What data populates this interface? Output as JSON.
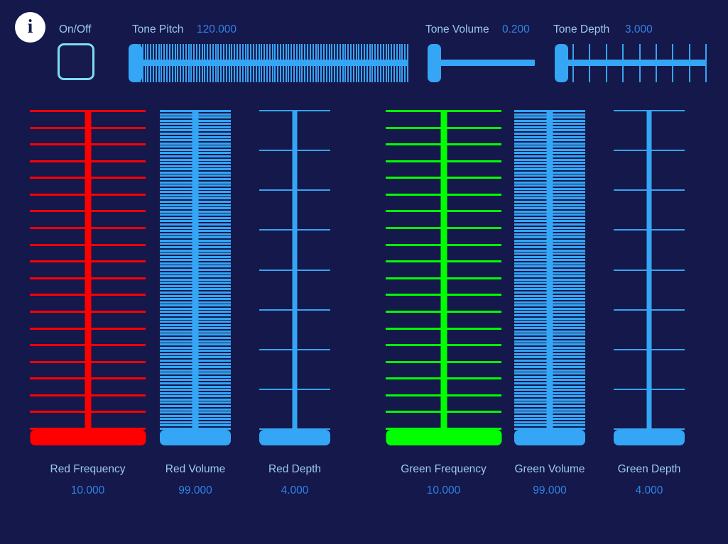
{
  "theme": {
    "background": "#15184a",
    "accent_blue": "#35a5f5",
    "label_color": "#9cc8f0",
    "value_color": "#2f83e8",
    "red": "#ff0000",
    "green": "#00ff00",
    "checkbox_border": "#7fdcf5",
    "info_bg": "#ffffff"
  },
  "header": {
    "info_icon": "info-icon",
    "info_glyph": "i",
    "onoff": {
      "label": "On/Off",
      "checked": false
    },
    "sliders": [
      {
        "name": "tone-pitch",
        "label": "Tone Pitch",
        "value": "120.000",
        "value_num": 120.0,
        "ticks": 100,
        "fill_ratio": 0.0,
        "color": "#35a5f5"
      },
      {
        "name": "tone-volume",
        "label": "Tone Volume",
        "value": "0.200",
        "value_num": 0.2,
        "ticks": 0,
        "fill_ratio": 0.0,
        "color": "#35a5f5"
      },
      {
        "name": "tone-depth",
        "label": "Tone Depth",
        "value": "3.000",
        "value_num": 3.0,
        "ticks": 9,
        "fill_ratio": 0.0,
        "color": "#35a5f5"
      }
    ]
  },
  "main": {
    "sliders": [
      {
        "name": "red-frequency",
        "label": "Red Frequency",
        "value": "10.000",
        "value_num": 10.0,
        "ticks": 20,
        "color": "#ff0000",
        "stem_width": 9,
        "tick_height": 3
      },
      {
        "name": "red-volume",
        "label": "Red Volume",
        "value": "99.000",
        "value_num": 99.0,
        "ticks": 99,
        "color": "#35a5f5",
        "stem_width": 9,
        "tick_height": 3
      },
      {
        "name": "red-depth",
        "label": "Red Depth",
        "value": "4.000",
        "value_num": 4.0,
        "ticks": 9,
        "color": "#35a5f5",
        "stem_width": 7,
        "tick_height": 2
      },
      {
        "name": "green-frequency",
        "label": "Green Frequency",
        "value": "10.000",
        "value_num": 10.0,
        "ticks": 20,
        "color": "#00ff00",
        "stem_width": 9,
        "tick_height": 3
      },
      {
        "name": "green-volume",
        "label": "Green Volume",
        "value": "99.000",
        "value_num": 99.0,
        "ticks": 99,
        "color": "#35a5f5",
        "stem_width": 9,
        "tick_height": 3
      },
      {
        "name": "green-depth",
        "label": "Green Depth",
        "value": "4.000",
        "value_num": 4.0,
        "ticks": 9,
        "color": "#35a5f5",
        "stem_width": 7,
        "tick_height": 2
      }
    ]
  }
}
